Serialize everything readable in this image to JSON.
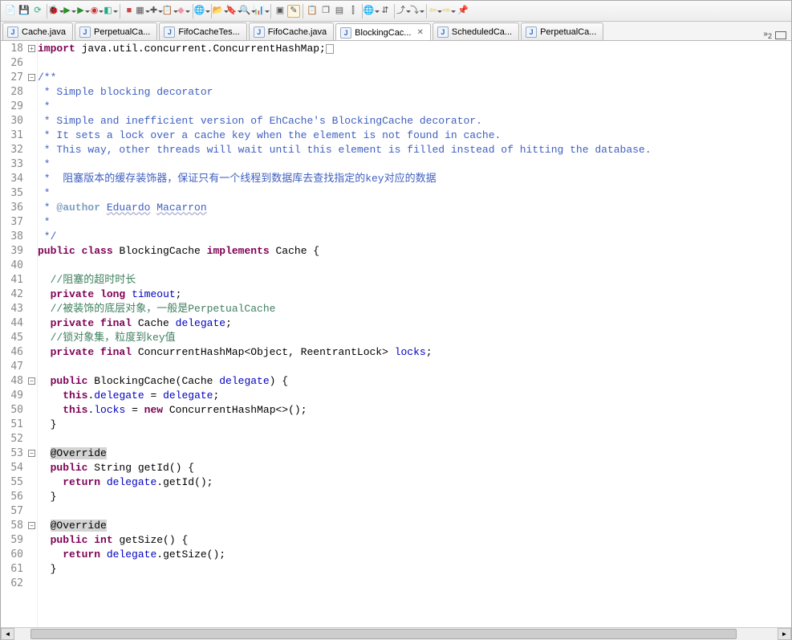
{
  "toolbar_icons": [
    {
      "name": "new-icon",
      "glyph": "📄"
    },
    {
      "name": "save-icon",
      "glyph": "💾"
    },
    {
      "name": "refresh-icon",
      "glyph": "⟳",
      "color": "#2a8"
    },
    {
      "name": "debug-icon",
      "glyph": "🐞",
      "drop": true
    },
    {
      "name": "run-icon",
      "glyph": "▶",
      "color": "#2a8f2a",
      "drop": true
    },
    {
      "name": "run-last-icon",
      "glyph": "▶",
      "color": "#2a8f2a",
      "drop": true
    },
    {
      "name": "coverage-icon",
      "glyph": "◉",
      "color": "#c33",
      "drop": true
    },
    {
      "name": "external-tools-icon",
      "glyph": "◧",
      "color": "#2a8",
      "drop": true
    },
    {
      "name": "stop-icon",
      "glyph": "■",
      "color": "#c44"
    },
    {
      "name": "build-icon",
      "glyph": "▦",
      "drop": true
    },
    {
      "name": "new-package-icon",
      "glyph": "✚",
      "drop": true
    },
    {
      "name": "task-icon",
      "glyph": "📋",
      "drop": true
    },
    {
      "name": "open-type-icon",
      "glyph": "◆",
      "color": "#e9a",
      "drop": true
    },
    {
      "name": "globe-icon",
      "glyph": "🌐",
      "drop": true
    },
    {
      "name": "open-file-icon",
      "glyph": "📂",
      "drop": true
    },
    {
      "name": "tag-icon",
      "glyph": "🔖",
      "drop": true
    },
    {
      "name": "search-icon",
      "glyph": "🔍",
      "drop": true
    },
    {
      "name": "profile-icon",
      "glyph": "📊",
      "drop": true
    },
    {
      "name": "task-toggle-icon",
      "glyph": "▣"
    },
    {
      "name": "edit-icon",
      "glyph": "✎",
      "boxed": true
    },
    {
      "name": "paste-icon",
      "glyph": "📋"
    },
    {
      "name": "copy-icon",
      "glyph": "❐"
    },
    {
      "name": "window-icon",
      "glyph": "▤"
    },
    {
      "name": "outline-icon",
      "glyph": "⫿"
    },
    {
      "name": "browser-icon",
      "glyph": "🌐",
      "drop": true
    },
    {
      "name": "sync-icon",
      "glyph": "⇵"
    },
    {
      "name": "forward-icon",
      "glyph": "⤴",
      "drop": true
    },
    {
      "name": "back-icon",
      "glyph": "⤵",
      "drop": true
    },
    {
      "name": "nav-back-icon",
      "glyph": "⇦",
      "color": "#e6c34a",
      "drop": true
    },
    {
      "name": "nav-forward-icon",
      "glyph": "⇨",
      "color": "#e6c34a",
      "drop": true
    },
    {
      "name": "pin-icon",
      "glyph": "📌"
    }
  ],
  "tabs": [
    {
      "name": "tab-cache",
      "label": "Cache.java"
    },
    {
      "name": "tab-perpetual1",
      "label": "PerpetualCa..."
    },
    {
      "name": "tab-fifotest",
      "label": "FifoCacheTes..."
    },
    {
      "name": "tab-fifo",
      "label": "FifoCache.java"
    },
    {
      "name": "tab-blocking",
      "label": "BlockingCac...",
      "active": true,
      "close": true
    },
    {
      "name": "tab-scheduled",
      "label": "ScheduledCa..."
    },
    {
      "name": "tab-perpetual2",
      "label": "PerpetualCa..."
    }
  ],
  "overflow_count": "2",
  "lines": [
    {
      "n": 18,
      "fold": "+",
      "html": "<span class='kw'>import</span> java.util.concurrent.ConcurrentHashMap;<span class='box'></span>"
    },
    {
      "n": 26,
      "html": ""
    },
    {
      "n": 27,
      "fold": "-",
      "html": "<span class='cm'>/**</span>"
    },
    {
      "n": 28,
      "html": "<span class='cm'> * Simple blocking decorator</span>"
    },
    {
      "n": 29,
      "html": "<span class='cm'> *</span>"
    },
    {
      "n": 30,
      "html": "<span class='cm'> * Simple and inefficient version of EhCache's BlockingCache decorator.</span>"
    },
    {
      "n": 31,
      "html": "<span class='cm'> * It sets a lock over a cache key when the element is not found in cache.</span>"
    },
    {
      "n": 32,
      "html": "<span class='cm'> * This way, other threads will wait until this element is filled instead of hitting the database.</span>"
    },
    {
      "n": 33,
      "html": "<span class='cm'> *</span>"
    },
    {
      "n": 34,
      "html": "<span class='cm'> *  阻塞版本的缓存装饰器，保证只有一个线程到数据库去查找指定的key对应的数据</span>"
    },
    {
      "n": 35,
      "html": "<span class='cm'> *</span>"
    },
    {
      "n": 36,
      "html": "<span class='cm'> * </span><span class='tag'>@author</span><span class='cm'> </span><span class='link'>Eduardo</span><span class='cm'> </span><span class='link'>Macarron</span>"
    },
    {
      "n": 37,
      "html": "<span class='cm'> *</span>"
    },
    {
      "n": 38,
      "html": "<span class='cm'> */</span>"
    },
    {
      "n": 39,
      "html": "<span class='kw'>public</span> <span class='kw'>class</span> BlockingCache <span class='kw'>implements</span> Cache {"
    },
    {
      "n": 40,
      "html": ""
    },
    {
      "n": 41,
      "html": "  <span class='cm2'>//阻塞的超时时长</span>"
    },
    {
      "n": 42,
      "html": "  <span class='kw'>private</span> <span class='kw'>long</span> <span class='fld'>timeout</span>;"
    },
    {
      "n": 43,
      "html": "  <span class='cm2'>//被装饰的底层对象，一般是PerpetualCache</span>"
    },
    {
      "n": 44,
      "html": "  <span class='kw'>private</span> <span class='kw'>final</span> Cache <span class='fld'>delegate</span>;"
    },
    {
      "n": 45,
      "html": "  <span class='cm2'>//锁对象集，粒度到key值</span>"
    },
    {
      "n": 46,
      "html": "  <span class='kw'>private</span> <span class='kw'>final</span> ConcurrentHashMap&lt;Object, ReentrantLock&gt; <span class='fld'>locks</span>;"
    },
    {
      "n": 47,
      "html": ""
    },
    {
      "n": 48,
      "fold": "-",
      "html": "  <span class='kw'>public</span> BlockingCache(Cache <span class='fld'>delegate</span>) {"
    },
    {
      "n": 49,
      "html": "    <span class='kw'>this</span>.<span class='fld'>delegate</span> = <span class='fld'>delegate</span>;"
    },
    {
      "n": 50,
      "html": "    <span class='kw'>this</span>.<span class='fld'>locks</span> = <span class='kw'>new</span> ConcurrentHashMap&lt;&gt;();"
    },
    {
      "n": 51,
      "html": "  }"
    },
    {
      "n": 52,
      "html": ""
    },
    {
      "n": 53,
      "fold": "-",
      "html": "  <span class='hl'>@Override</span>"
    },
    {
      "n": 54,
      "html": "  <span class='kw'>public</span> String getId() {"
    },
    {
      "n": 55,
      "html": "    <span class='kw'>return</span> <span class='fld'>delegate</span>.getId();"
    },
    {
      "n": 56,
      "html": "  }"
    },
    {
      "n": 57,
      "html": ""
    },
    {
      "n": 58,
      "fold": "-",
      "html": "  <span class='hl'>@Override</span>"
    },
    {
      "n": 59,
      "html": "  <span class='kw'>public</span> <span class='kw'>int</span> getSize() {"
    },
    {
      "n": 60,
      "html": "    <span class='kw'>return</span> <span class='fld'>delegate</span>.getSize();"
    },
    {
      "n": 61,
      "html": "  }"
    },
    {
      "n": 62,
      "html": ""
    }
  ]
}
